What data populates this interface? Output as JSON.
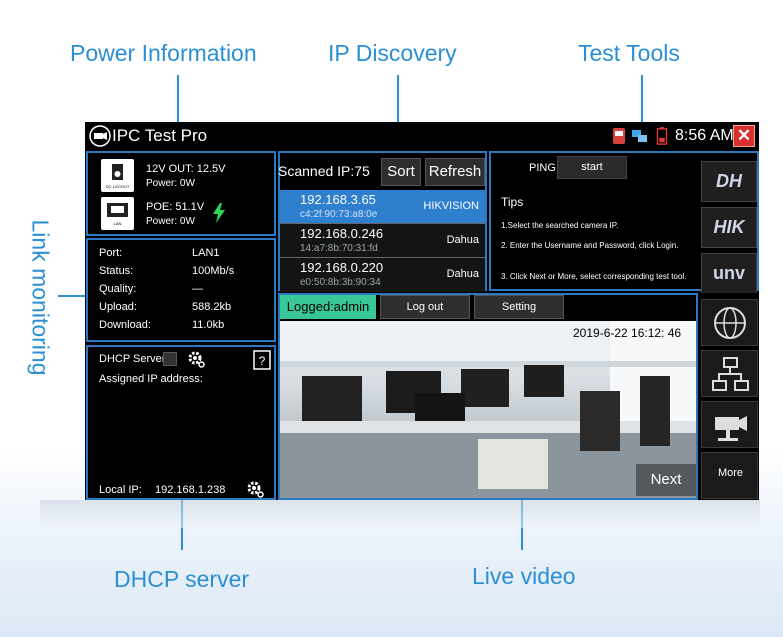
{
  "callouts": {
    "power": "Power Information",
    "ip": "IP Discovery",
    "tools": "Test Tools",
    "link": "Link monitoring",
    "dhcp": "DHCP server",
    "video": "Live video"
  },
  "titlebar": {
    "app_title": "IPC Test Pro",
    "time": "8:56 AM"
  },
  "power": {
    "dc_line1": "12V OUT: 12.5V",
    "dc_line2": "Power: 0W",
    "dc_icon_label": "DC 12V/OUT",
    "poe_line1": "POE: 51.1V",
    "poe_line2": "Power: 0W",
    "poe_icon_label": "LAN"
  },
  "link": {
    "rows": [
      {
        "label": "Port:",
        "value": "LAN1"
      },
      {
        "label": "Status:",
        "value": "100Mb/s"
      },
      {
        "label": "Quality:",
        "value": "—"
      },
      {
        "label": "Upload:",
        "value": "588.2kb"
      },
      {
        "label": "Download:",
        "value": "11.0kb"
      }
    ]
  },
  "dhcp": {
    "server_label": "DHCP Server:",
    "assigned_label": "Assigned IP address:",
    "local_ip_label": "Local IP:",
    "local_ip": "192.168.1.238"
  },
  "ip_discovery": {
    "scanned": "Scanned IP:75",
    "sort_label": "Sort",
    "refresh_label": "Refresh",
    "rows": [
      {
        "ip": "192.168.3.65",
        "mac": "c4:2f:90:73:a8:0e",
        "brand": "HIKVISION"
      },
      {
        "ip": "192.168.0.246",
        "mac": "14:a7:8b:70:31:fd",
        "brand": "Dahua"
      },
      {
        "ip": "192.168.0.220",
        "mac": "e0:50:8b:3b:90:34",
        "brand": "Dahua"
      }
    ]
  },
  "tools": {
    "ping_label": "PING",
    "start_label": "start",
    "tips_title": "Tips",
    "tip1": "1.Select the searched camera IP.",
    "tip2": "2. Enter the Username and Password, click Login.",
    "tip3": "3. Click Next or More, select corresponding test tool.",
    "brands": [
      "DH",
      "HIK",
      "unv"
    ]
  },
  "video": {
    "logged": "Logged:admin",
    "logout_label": "Log out",
    "setting_label": "Setting",
    "timestamp": "2019-6-22 16:12: 46",
    "next_label": "Next",
    "more_label": "More"
  },
  "colors": {
    "accent": "#2a8fd4",
    "panel_border": "#2b79c2",
    "selected_row": "#2f7fcf",
    "logged_bg": "#39c79a",
    "close": "#d8312d"
  }
}
